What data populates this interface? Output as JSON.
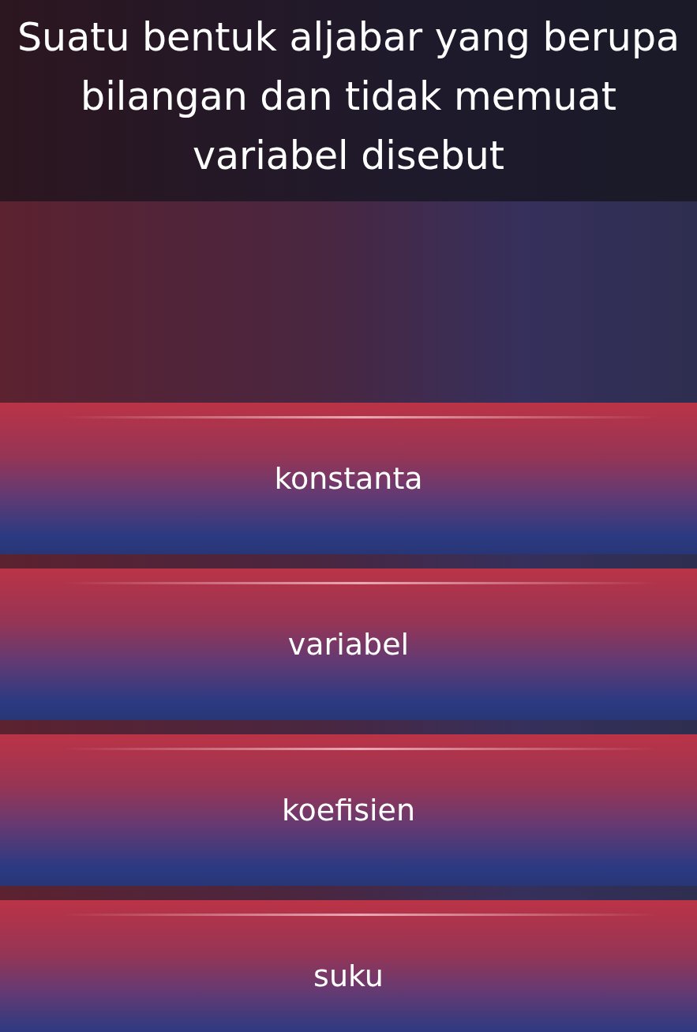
{
  "question": "Suatu bentuk aljabar yang berupa bilangan dan tidak memuat variabel disebut",
  "answers": [
    {
      "text": "konstanta"
    },
    {
      "text": "variabel"
    },
    {
      "text": "koefisien"
    },
    {
      "text": "suku"
    }
  ]
}
